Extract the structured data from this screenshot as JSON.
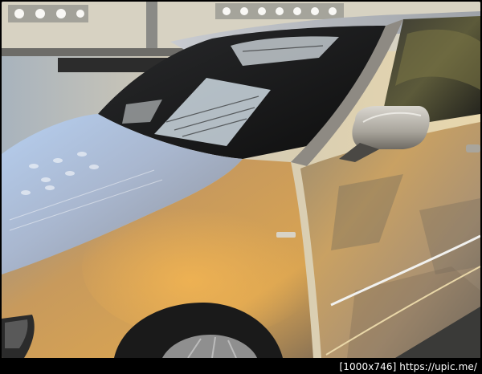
{
  "image": {
    "caption": "[1000x746] https://upic.me/",
    "subject": "silver sedan in sunlight",
    "colors": {
      "wall": "#c9c3b4",
      "car_silver": "#9ea3a8",
      "highlight_gold": "#e0a24a",
      "sky_blue_reflection": "#b9d4f2",
      "glass_dark": "#141414",
      "border": "#000000"
    }
  }
}
